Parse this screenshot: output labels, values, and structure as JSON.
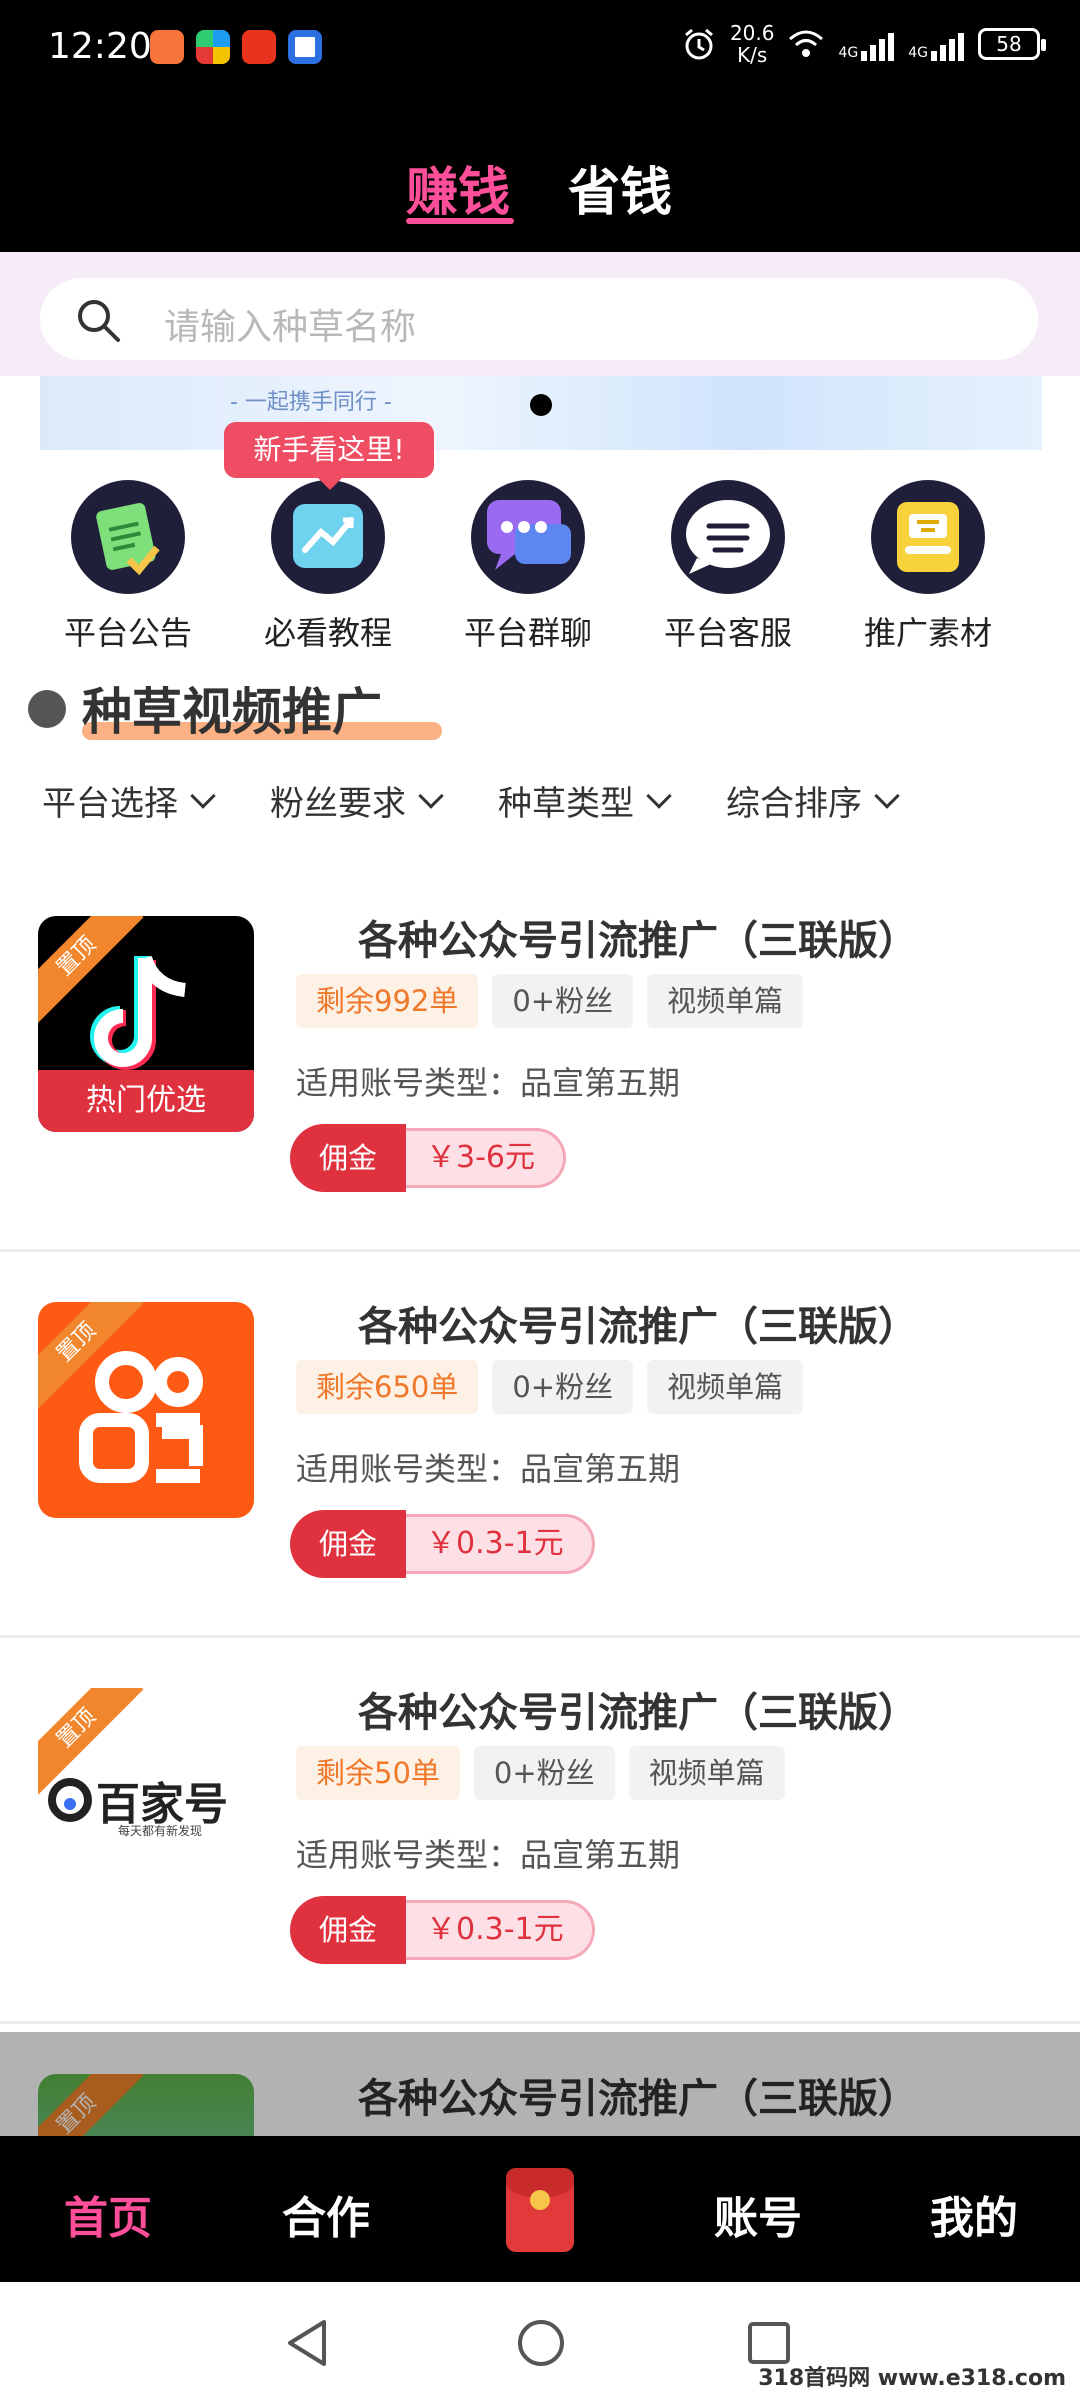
{
  "status_bar": {
    "time": "12:20",
    "speed": "20.6",
    "speed_unit": "K/s",
    "net1": "4G",
    "net2": "4G",
    "battery": "58"
  },
  "top_tabs": [
    {
      "label": "赚钱",
      "active": true
    },
    {
      "label": "省钱",
      "active": false
    }
  ],
  "search": {
    "placeholder": "请输入种草名称"
  },
  "banner": {
    "text": "- 一起携手同行 -"
  },
  "tooltip": "新手看这里!",
  "quick_links": [
    {
      "label": "平台公告",
      "icon": "notice-icon"
    },
    {
      "label": "必看教程",
      "icon": "tutorial-icon"
    },
    {
      "label": "平台群聊",
      "icon": "group-chat-icon"
    },
    {
      "label": "平台客服",
      "icon": "customer-service-icon"
    },
    {
      "label": "推广素材",
      "icon": "material-icon"
    }
  ],
  "section_title": "种草视频推广",
  "filters": [
    "平台选择",
    "粉丝要求",
    "种草类型",
    "综合排序"
  ],
  "cards": [
    {
      "logo": "douyin-logo",
      "pin": "置顶",
      "logo_caption": "热门优选",
      "title": "各种公众号引流推广（三联版）",
      "tags": [
        "剩余992单",
        "0+粉丝",
        "视频单篇"
      ],
      "account_type": "适用账号类型：品宣第五期",
      "commission_label": "佣金",
      "commission": "￥3-6元"
    },
    {
      "logo": "kuaishou-logo",
      "pin": "置顶",
      "title": "各种公众号引流推广（三联版）",
      "tags": [
        "剩余650单",
        "0+粉丝",
        "视频单篇"
      ],
      "account_type": "适用账号类型：品宣第五期",
      "commission_label": "佣金",
      "commission": "￥0.3-1元"
    },
    {
      "logo": "baijiahao-logo",
      "pin": "置顶",
      "logo_text": "百家号",
      "logo_sub": "每天都有新发现",
      "title": "各种公众号引流推广（三联版）",
      "tags": [
        "剩余50单",
        "0+粉丝",
        "视频单篇"
      ],
      "account_type": "适用账号类型：品宣第五期",
      "commission_label": "佣金",
      "commission": "￥0.3-1元"
    },
    {
      "logo": "partial-logo",
      "pin": "置顶",
      "title": "各种公众号引流推广（三联版）"
    }
  ],
  "bottom_nav": [
    {
      "label": "首页",
      "active": true
    },
    {
      "label": "合作"
    },
    {
      "label": "",
      "icon": "red-packet-icon"
    },
    {
      "label": "账号"
    },
    {
      "label": "我的"
    }
  ],
  "watermark": "318首码网 www.e318.com",
  "colors": {
    "accent_pink": "#ff4f9a",
    "commission_red": "#e0313e",
    "tag_orange": "#f0782b"
  }
}
